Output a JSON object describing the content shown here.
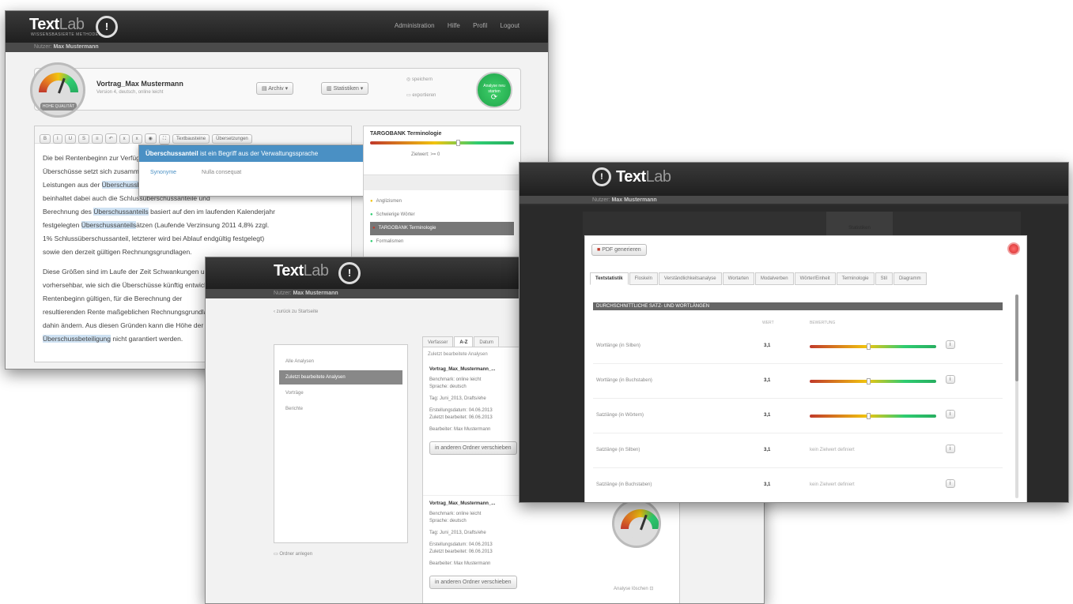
{
  "app": {
    "name_bold": "Text",
    "name_light": "Lab",
    "subtitle": "WISSENSBASIERTE METHODEN",
    "badge": "!"
  },
  "nav": {
    "admin": "Administration",
    "help": "Hilfe",
    "profile": "Profil",
    "logout": "Logout"
  },
  "breadcrumb": {
    "prefix": "Nutzer:",
    "user": "Max Mustermann"
  },
  "editor": {
    "doc_title": "Vortrag_Max Mustermann",
    "doc_meta": "Version 4, deutsch, online leicht",
    "gauge_label": "HOHE QUALITÄT",
    "archive_btn": "Archiv",
    "stats_btn": "Statistiken",
    "save_opt": "speichern",
    "export_opt": "exportieren",
    "analyze_btn": "Analyse neu starten",
    "toolbar": [
      "B",
      "I",
      "U",
      "S",
      "≡",
      "↶",
      "x",
      "x",
      "◉",
      "⛶",
      "Textbausteine",
      "Übersetzungen"
    ],
    "text_lines": [
      "Die bei Rentenbeginn zur Verfügung stehenden",
      "Überschüsse setzt sich zusammen aus",
      "Leistungen aus der Überschussbeteiligung",
      "beinhaltet dabei auch die Schlussüberschussanteile und",
      "Berechnung des Überschussanteils basiert auf den im laufenden Kalenderjahr",
      "festgelegten Überschussanteilsätzen (Laufende Verzinsung 2011 4,8% zzgl.",
      "1% Schlussüberschussanteil, letzterer wird bei Ablauf endgültig festgelegt)",
      "sowie den derzeit gültigen Rechnungsgrundlagen.",
      "",
      "Diese Größen sind im Laufe der Zeit Schwankungen unterworfen",
      "vorhersehbar, wie sich die Überschüsse künftig entwickeln",
      "Rentenbeginn gültigen, für die Berechnung der",
      "resultierenden Rente maßgeblichen Rechnungsgrundlagen",
      "dahin ändern. Aus diesen Gründen kann die Höhe der",
      "Überschussbeteiligung nicht garantiert werden."
    ],
    "popup": {
      "term": "Überschussanteil",
      "rest": "ist ein Begriff aus der Verwaltungssprache",
      "synonyms": "Synonyme",
      "none": "Nulla consequat"
    },
    "side_title": "TARGOBANK Terminologie",
    "side_meta": "Zielwert: >= 0",
    "side_items": [
      "Anglizismen",
      "Schwierige Wörter",
      "TARGOBANK Terminologie",
      "Formalismen"
    ]
  },
  "archive": {
    "back": "zurück zu Startseite",
    "folders": [
      "Alle Analysen",
      "Zuletzt bearbeitete Analysen",
      "Vorträge",
      "Berichte"
    ],
    "new_folder": "Ordner anlegen",
    "tabs": [
      "Verfasser",
      "A-Z",
      "Datum"
    ],
    "list_header": "Zuletzt bearbeitete Analysen",
    "items": [
      {
        "title": "Vortrag_Max_Mustermann_...",
        "benchmark": "Benchmark: online leicht",
        "lang": "Sprache: deutsch",
        "tag": "Tag: Juni_2013, Drafts/ehe",
        "created": "Erstellungsdatum: 04.06.2013",
        "edited": "Zuletzt bearbeitet: 06.06.2013",
        "editor": "Bearbeiter: Max Mustermann",
        "move": "in anderen Ordner verschieben"
      },
      {
        "title": "Vortrag_Max_Mustermann_...",
        "benchmark": "Benchmark: online leicht",
        "lang": "Sprache: deutsch",
        "tag": "Tag: Juni_2013, Drafts/ehe",
        "created": "Erstellungsdatum: 04.06.2013",
        "edited": "Zuletzt bearbeitet: 06.06.2013",
        "editor": "Bearbeiter: Max Mustermann",
        "move": "in anderen Ordner verschieben"
      }
    ],
    "analyze_link": "Analyse löschen"
  },
  "stats": {
    "pdf_btn": "PDF generieren",
    "tabs": [
      "Textstatistik",
      "Floskeln",
      "Verständlichkeitsanalyse",
      "Wortarten",
      "Modalverben",
      "Wörter/Einheit",
      "Terminologie",
      "Stil",
      "Diagramm"
    ],
    "section": "DURCHSCHNITTLICHE SATZ- UND WORTLÄNGEN",
    "col_value": "WERT",
    "col_score": "BEWERTUNG",
    "rows": [
      {
        "label": "Wortlänge (in Silben)",
        "value": "3,1",
        "score": 0.45,
        "note": ""
      },
      {
        "label": "Wortlänge (in Buchstaben)",
        "value": "3,1",
        "score": 0.45,
        "note": ""
      },
      {
        "label": "Satzlänge (in Wörtern)",
        "value": "3,1",
        "score": 0.45,
        "note": ""
      },
      {
        "label": "Satzlänge (in Silben)",
        "value": "3,1",
        "score": null,
        "note": "kein Zielwert definiert"
      },
      {
        "label": "Satzlänge (in Buchstaben)",
        "value": "3,1",
        "score": null,
        "note": "kein Zielwert definiert"
      }
    ]
  }
}
